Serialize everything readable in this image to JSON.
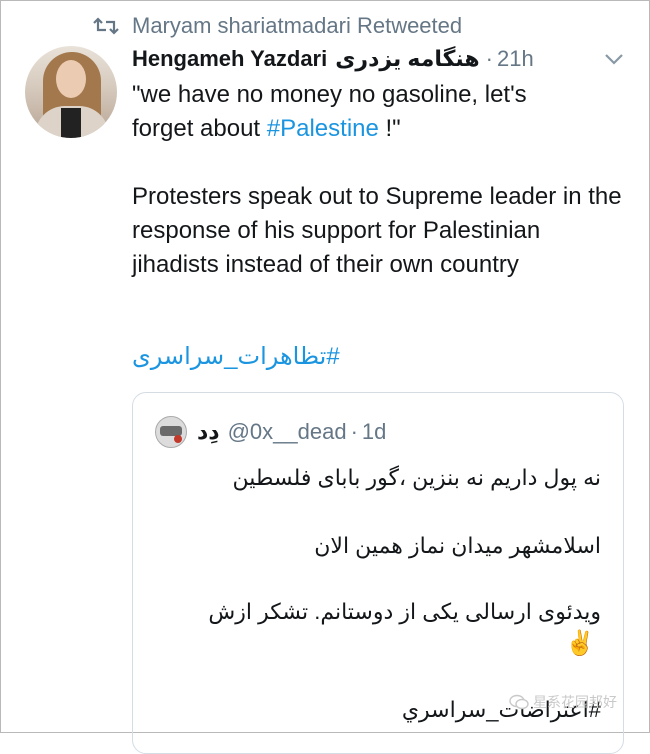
{
  "retweet": {
    "text": "Maryam shariatmadari Retweeted"
  },
  "author": {
    "name": "Hengameh Yazdari",
    "name_fa": "هنگامه یزدری",
    "dot": "·",
    "time": "21h"
  },
  "tweet": {
    "line1": "\"we have no money no gasoline, let's",
    "line2_prefix": "forget about ",
    "line2_hashtag": "#Palestine",
    "line2_suffix": " !\"",
    "paragraph": "Protesters speak out to Supreme leader in the response of his support for Palestinian jihadists instead of their own country",
    "hashtag_fa": "#تظاهرات_سراسری"
  },
  "quoted": {
    "name": "دِد",
    "handle": "@0x__dead",
    "dot": "·",
    "time": "1d",
    "line1": "نه پول داریم نه بنزین ،گور بابای فلسطین",
    "line2": "اسلامشهر میدان نماز همین الان",
    "line3": "ویدئوی ارسالی یکی از دوستانم. تشکر ازش",
    "emoji": "✌️",
    "hashtag": "#اعتراضات_سراسري"
  },
  "watermark": {
    "text": "星系花园邦好"
  },
  "colors": {
    "link": "#1b95e0",
    "muted": "#657786",
    "text": "#14171a"
  }
}
